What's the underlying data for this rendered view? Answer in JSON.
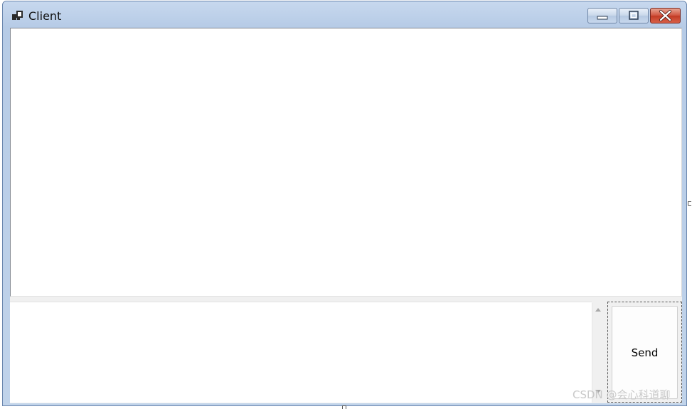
{
  "window": {
    "title": "Client",
    "icon": "app-form-icon",
    "controls": [
      "minimize-icon",
      "maximize-icon",
      "close-icon"
    ]
  },
  "chat": {
    "display_text": "",
    "input_text": "",
    "send_label": "Send"
  },
  "watermark": "CSDN @会心科道聊"
}
